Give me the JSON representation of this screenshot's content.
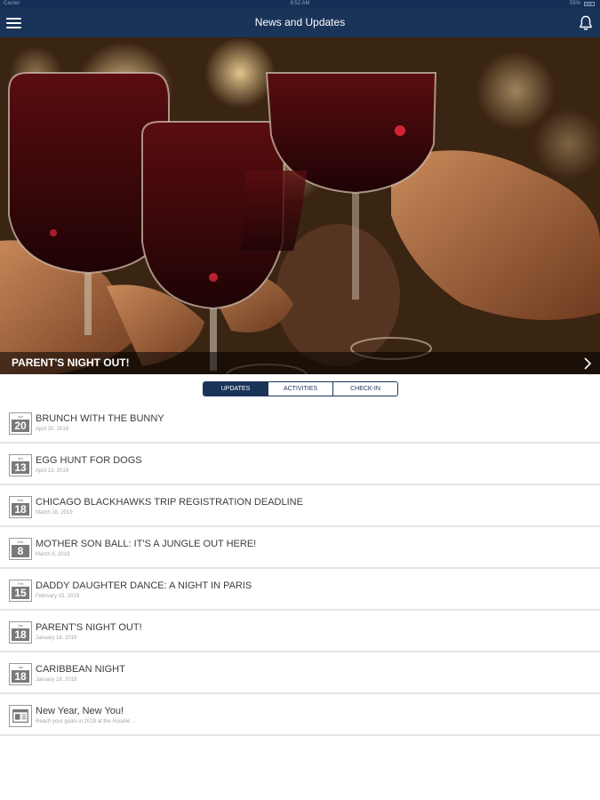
{
  "status_bar": {
    "carrier": "Carrier",
    "time": "8:52 AM",
    "battery": "55%"
  },
  "header": {
    "title": "News and Updates",
    "menu_icon": "hamburger-menu-icon",
    "notification_icon": "bell-icon"
  },
  "hero": {
    "caption": "PARENT'S NIGHT OUT!",
    "chevron_icon": "chevron-right-icon"
  },
  "tabs": [
    {
      "label": "UPDATES",
      "active": true
    },
    {
      "label": "ACTIVITIES",
      "active": false
    },
    {
      "label": "CHECK-IN",
      "active": false
    }
  ],
  "items": [
    {
      "month": "Apr",
      "day": "20",
      "title": "BRUNCH WITH THE BUNNY",
      "date": "April 20, 2019"
    },
    {
      "month": "Apr",
      "day": "13",
      "title": "EGG HUNT FOR DOGS",
      "date": "April 13, 2019"
    },
    {
      "month": "Mar",
      "day": "18",
      "title": "CHICAGO BLACKHAWKS TRIP REGISTRATION DEADLINE",
      "date": "March 18, 2019"
    },
    {
      "month": "Mar",
      "day": "8",
      "title": "MOTHER SON BALL: IT'S A JUNGLE OUT HERE!",
      "date": "March 8, 2019"
    },
    {
      "month": "Feb",
      "day": "15",
      "title": "DADDY DAUGHTER DANCE: A NIGHT IN PARIS",
      "date": "February 15, 2019"
    },
    {
      "month": "Jan",
      "day": "18",
      "title": "PARENT'S NIGHT OUT!",
      "date": "January 18, 2019"
    },
    {
      "month": "Jan",
      "day": "18",
      "title": "CARIBBEAN NIGHT",
      "date": "January 18, 2019"
    }
  ],
  "news_item": {
    "title": "New Year, New You!",
    "summary": "Reach your goals in 2019 at the Roselle ...",
    "icon": "newspaper-icon"
  },
  "colors": {
    "nav_bg": "#1a3459",
    "accent": "#1a3459",
    "calendar_day_bg": "#7a7a7a"
  }
}
